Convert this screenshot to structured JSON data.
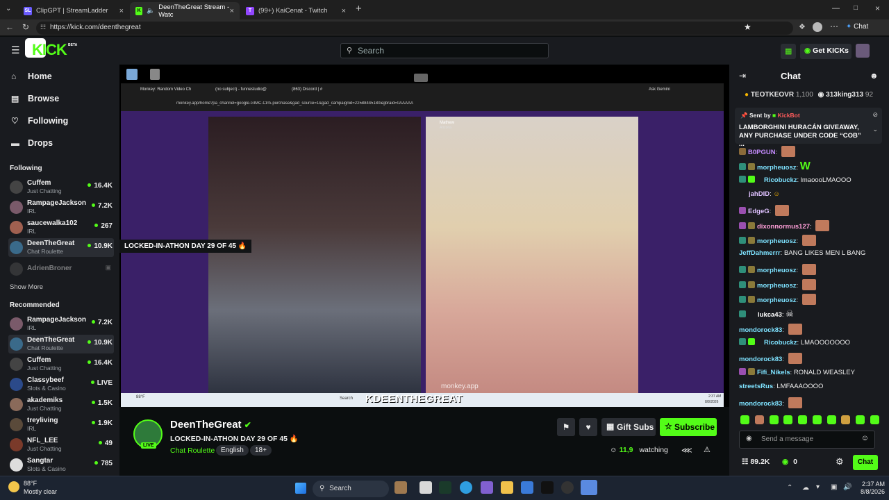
{
  "browser": {
    "tabs": [
      {
        "title": "ClipGPT | StreamLadder",
        "favicon": "SL"
      },
      {
        "title": "DeenTheGreat Stream - Watc",
        "favicon": "K"
      },
      {
        "title": "(99+) KaiCenat - Twitch",
        "favicon": "T"
      }
    ],
    "url": "https://kick.com/deenthegreat",
    "profile_label": "Chat"
  },
  "header": {
    "logo": "KICK",
    "logo_superscript": "BETA",
    "search_placeholder": "Search",
    "get_kicks_label": "Get KICKs"
  },
  "nav": [
    {
      "label": "Home",
      "icon": "home-icon"
    },
    {
      "label": "Browse",
      "icon": "browse-icon"
    },
    {
      "label": "Following",
      "icon": "heart-icon"
    },
    {
      "label": "Drops",
      "icon": "drops-icon"
    }
  ],
  "following": {
    "heading": "Following",
    "channels": [
      {
        "name": "Cuffem",
        "category": "Just Chatting",
        "viewers": "16.4K"
      },
      {
        "name": "RampageJackson",
        "category": "IRL",
        "viewers": "7.2K"
      },
      {
        "name": "saucewalka102",
        "category": "IRL",
        "viewers": "267"
      },
      {
        "name": "DeenTheGreat",
        "category": "Chat Roulette",
        "viewers": "10.9K"
      },
      {
        "name": "AdrienBroner",
        "category": "",
        "viewers": ""
      }
    ],
    "show_more": "Show More"
  },
  "recommended": {
    "heading": "Recommended",
    "channels": [
      {
        "name": "RampageJackson",
        "category": "IRL",
        "viewers": "7.2K"
      },
      {
        "name": "DeenTheGreat",
        "category": "Chat Roulette",
        "viewers": "10.9K"
      },
      {
        "name": "Cuffem",
        "category": "Just Chatting",
        "viewers": "16.4K"
      },
      {
        "name": "Classybeef",
        "category": "Slots & Casino",
        "viewers": "LIVE"
      },
      {
        "name": "akademiks",
        "category": "Just Chatting",
        "viewers": "1.5K"
      },
      {
        "name": "treyliving",
        "category": "IRL",
        "viewers": "1.9K"
      },
      {
        "name": "NFL_LEE",
        "category": "Just Chatting",
        "viewers": "49"
      },
      {
        "name": "Sangtar",
        "category": "Slots & Casino",
        "viewers": "785"
      }
    ]
  },
  "video": {
    "overlay_title": "LOCKED-IN-ATHON DAY 29 OF 45 🔥",
    "overlay_name": "KDEENTHEGREAT",
    "inner_url": "monkey.app/home?pa_channel=google-GIMC-CPA-purchase&gad_source=1&gad_campaignid=22588445180&gbraid=0AAAAA",
    "inner_tabs": [
      "Monkey: Random Video Ch",
      "(no subject) - funnestudio@",
      "(863) Discord | #"
    ],
    "remote_user": "Mathew",
    "remote_user_country": "Arizona",
    "watermark": "monkey.app",
    "inner_weather": "88°F",
    "inner_time": "2:37 AM",
    "inner_date": "8/8/2026",
    "ask_label": "Ask Gemini"
  },
  "stream": {
    "name": "DeenTheGreat",
    "title": "LOCKED-IN-ATHON DAY 29 OF 45 🔥",
    "category": "Chat Roulette",
    "tags": [
      "English",
      "18+"
    ],
    "live_label": "LIVE",
    "viewers": "11,9",
    "viewers_suffix": "watching",
    "gift_label": "Gift Subs",
    "subscribe_label": "Subscribe"
  },
  "chat": {
    "title": "Chat",
    "leaderboard": [
      {
        "user": "TEOTKEOVR",
        "amount": "1,100"
      },
      {
        "user": "313king313",
        "amount": "92"
      }
    ],
    "pinned_sender_label": "Sent by",
    "pinned_sender": "KickBot",
    "pinned_text": "LAMBORGHINI HURACÁN GIVEAWAY, ANY PURCHASE UNDER CODE “COB” ...",
    "messages": [
      {
        "user": "B0PGUN",
        "text": "",
        "color": "#c58cff"
      },
      {
        "user": "morpheuosz",
        "text": "W",
        "color": "#7ee2ff"
      },
      {
        "user": "Ricobuckz",
        "text": "lmaoooLMAOOO",
        "color": "#7ee2ff"
      },
      {
        "user": "jahDID",
        "text": "",
        "color": "#dfc1ff"
      },
      {
        "user": "EdgeG",
        "text": "",
        "color": "#dfc1ff"
      },
      {
        "user": "dixonnormus127",
        "text": "",
        "color": "#ff9fd8"
      },
      {
        "user": "morpheuosz",
        "text": "",
        "color": "#7ee2ff"
      },
      {
        "user": "JeffDahmerrr",
        "text": "BANG LIKES MEN L BANG",
        "color": "#7ee2ff"
      },
      {
        "user": "morpheuosz",
        "text": "",
        "color": "#7ee2ff"
      },
      {
        "user": "morpheuosz",
        "text": "",
        "color": "#7ee2ff"
      },
      {
        "user": "morpheuosz",
        "text": "",
        "color": "#7ee2ff"
      },
      {
        "user": "lukca43",
        "text": "",
        "color": "#ffffff"
      },
      {
        "user": "mondorock83",
        "text": "",
        "color": "#7ee2ff"
      },
      {
        "user": "Ricobuckz",
        "text": "LMAOOOOOOO",
        "color": "#7ee2ff"
      },
      {
        "user": "mondorock83",
        "text": "",
        "color": "#7ee2ff"
      },
      {
        "user": "Fifi_Nikels",
        "text": "RONALD WEASLEY",
        "color": "#7ee2ff"
      },
      {
        "user": "streetsRus",
        "text": "LMFAAAOOOO",
        "color": "#7ee2ff"
      },
      {
        "user": "mondorock83",
        "text": "",
        "color": "#7ee2ff"
      }
    ],
    "input_placeholder": "Send a message",
    "followers": "89.2K",
    "kicks": "0",
    "send_label": "Chat"
  },
  "os": {
    "weather_temp": "88°F",
    "weather_desc": "Mostly clear",
    "search_label": "Search",
    "time": "2:37 AM",
    "date": "8/8/2026"
  },
  "colors": {
    "accent": "#53fc18",
    "background": "#0b0e0f",
    "panel": "#191b1f"
  }
}
